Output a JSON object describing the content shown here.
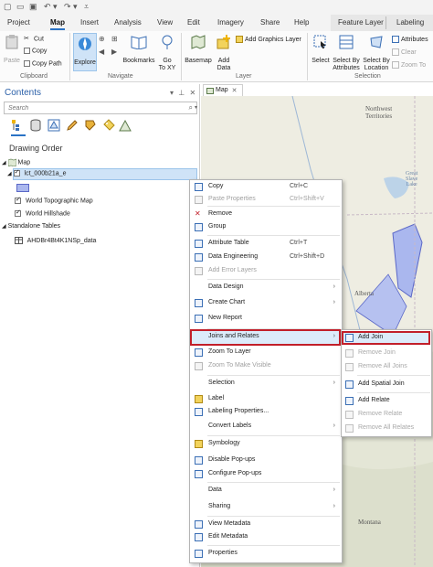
{
  "tabs": {
    "project": "Project",
    "map": "Map",
    "insert": "Insert",
    "analysis": "Analysis",
    "view": "View",
    "edit": "Edit",
    "imagery": "Imagery",
    "share": "Share",
    "help": "Help",
    "feature_layer": "Feature Layer",
    "labeling": "Labeling"
  },
  "ribbon": {
    "paste": "Paste",
    "cut": "Cut",
    "copy": "Copy",
    "copy_path": "Copy Path",
    "clipboard": "Clipboard",
    "explore": "Explore",
    "bookmarks": "Bookmarks",
    "go_to_xy": "Go\nTo XY",
    "navigate": "Navigate",
    "basemap": "Basemap",
    "add_data": "Add\nData",
    "add_graphics_layer": "Add Graphics Layer",
    "layer": "Layer",
    "select": "Select",
    "select_by_attributes": "Select By\nAttributes",
    "select_by_location": "Select By\nLocation",
    "attributes": "Attributes",
    "clear": "Clear",
    "zoom_to": "Zoom To",
    "selection": "Selection"
  },
  "contents": {
    "title": "Contents",
    "search_placeholder": "Search",
    "drawing_order": "Drawing Order",
    "map": "Map",
    "layer_selected": "lct_000b21a_e",
    "world_topo": "World Topographic Map",
    "world_hillshade": "World Hillshade",
    "standalone_tables": "Standalone Tables",
    "table_name": "AHDBr4Bt4K1NSp_data"
  },
  "map_tab": "Map",
  "map_labels": {
    "northwest_territories": "Northwest\nTerritories",
    "great_slave_lake": "Great\nSlave\nLake",
    "alberta": "Alberta",
    "montana": "Montana"
  },
  "context_menu": [
    {
      "label": "Copy",
      "shortcut": "Ctrl+C",
      "icon": "copy-icon",
      "enabled": true
    },
    {
      "label": "Paste Properties",
      "shortcut": "Ctrl+Shift+V",
      "icon": "paste-properties-icon",
      "enabled": false
    },
    {
      "label": "Remove",
      "shortcut": "",
      "icon": "remove-icon",
      "enabled": true
    },
    {
      "label": "Group",
      "shortcut": "",
      "icon": "group-icon",
      "enabled": true
    },
    {
      "label": "Attribute Table",
      "shortcut": "Ctrl+T",
      "icon": "attribute-table-icon",
      "enabled": true
    },
    {
      "label": "Data Engineering",
      "shortcut": "Ctrl+Shift+D",
      "icon": "data-engineering-icon",
      "enabled": true
    },
    {
      "label": "Add Error Layers",
      "shortcut": "",
      "icon": "add-error-layers-icon",
      "enabled": false
    },
    {
      "label": "Data Design",
      "shortcut": "",
      "icon": "",
      "enabled": true,
      "submenu": true
    },
    {
      "label": "Create Chart",
      "shortcut": "",
      "icon": "create-chart-icon",
      "enabled": true,
      "submenu": true
    },
    {
      "label": "New Report",
      "shortcut": "",
      "icon": "new-report-icon",
      "enabled": true
    },
    {
      "label": "Joins and Relates",
      "shortcut": "",
      "icon": "",
      "enabled": true,
      "submenu": true
    },
    {
      "label": "Zoom To Layer",
      "shortcut": "",
      "icon": "zoom-to-layer-icon",
      "enabled": true
    },
    {
      "label": "Zoom To Make Visible",
      "shortcut": "",
      "icon": "zoom-make-visible-icon",
      "enabled": false
    },
    {
      "label": "Selection",
      "shortcut": "",
      "icon": "",
      "enabled": true,
      "submenu": true
    },
    {
      "label": "Label",
      "shortcut": "",
      "icon": "label-icon",
      "enabled": true
    },
    {
      "label": "Labeling Properties...",
      "shortcut": "",
      "icon": "labeling-properties-icon",
      "enabled": true
    },
    {
      "label": "Convert Labels",
      "shortcut": "",
      "icon": "",
      "enabled": true,
      "submenu": true
    },
    {
      "label": "Symbology",
      "shortcut": "",
      "icon": "symbology-icon",
      "enabled": true
    },
    {
      "label": "Disable Pop-ups",
      "shortcut": "",
      "icon": "disable-popups-icon",
      "enabled": true
    },
    {
      "label": "Configure Pop-ups",
      "shortcut": "",
      "icon": "configure-popups-icon",
      "enabled": true
    },
    {
      "label": "Data",
      "shortcut": "",
      "icon": "",
      "enabled": true,
      "submenu": true
    },
    {
      "label": "Sharing",
      "shortcut": "",
      "icon": "",
      "enabled": true,
      "submenu": true
    },
    {
      "label": "View Metadata",
      "shortcut": "",
      "icon": "view-metadata-icon",
      "enabled": true
    },
    {
      "label": "Edit Metadata",
      "shortcut": "",
      "icon": "edit-metadata-icon",
      "enabled": true
    },
    {
      "label": "Properties",
      "shortcut": "",
      "icon": "properties-icon",
      "enabled": true
    }
  ],
  "submenu": [
    {
      "label": "Add Join",
      "icon": "add-join-icon",
      "enabled": true
    },
    {
      "label": "Remove Join",
      "icon": "remove-join-icon",
      "enabled": false
    },
    {
      "label": "Remove All Joins",
      "icon": "remove-all-joins-icon",
      "enabled": false
    },
    {
      "label": "Add Spatial Join",
      "icon": "add-spatial-join-icon",
      "enabled": true
    },
    {
      "label": "Add Relate",
      "icon": "add-relate-icon",
      "enabled": true
    },
    {
      "label": "Remove Relate",
      "icon": "remove-relate-icon",
      "enabled": false
    },
    {
      "label": "Remove All Relates",
      "icon": "remove-all-relates-icon",
      "enabled": false
    }
  ],
  "colors": {
    "accent": "#2a73c5",
    "highlight_border": "#c21f2a",
    "layer_fill": "#aab7ee"
  }
}
